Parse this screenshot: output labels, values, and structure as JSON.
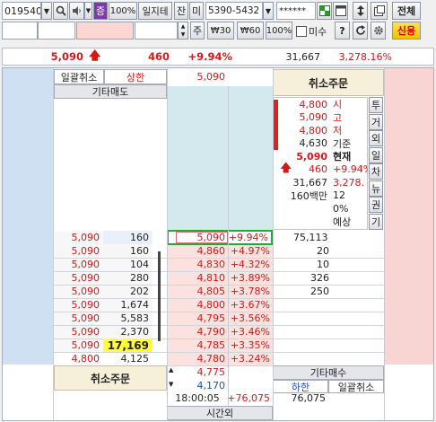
{
  "toolbar": {
    "code": "019540",
    "buttons": [
      "증",
      "100%",
      "일지테",
      "잔",
      "미"
    ],
    "range": "5390-5432",
    "password": "******",
    "all_label": "전체",
    "stepper_value": "",
    "step_up": "주",
    "qty_presets": [
      "₩30",
      "₩60",
      "100%"
    ],
    "unfilled_label": "미수",
    "help_label": "?",
    "credit_label": "신용"
  },
  "summary": {
    "price": "5,090",
    "change": "460",
    "change_pct": "+9.94%",
    "volume": "31,667",
    "amount": "3,278.16%"
  },
  "top": {
    "bulk_cancel": "일괄취소",
    "upper_limit_label": "상한",
    "upper_limit": "5,090",
    "other_sell": "기타매도",
    "cancel_order": "취소주문"
  },
  "info_panel": {
    "rows": [
      {
        "value": "4,800",
        "label": "시",
        "color": "red"
      },
      {
        "value": "5,090",
        "label": "고",
        "color": "red"
      },
      {
        "value": "4,800",
        "label": "저",
        "color": "red"
      },
      {
        "value": "4,630",
        "label": "기준",
        "color": "dark"
      },
      {
        "value": "5,090",
        "label": "현재",
        "color": "red"
      },
      {
        "value": "460",
        "label": "+9.94%",
        "color": "red"
      },
      {
        "value": "31,667",
        "label": "3,278.",
        "color": "mixed"
      },
      {
        "value": "160백만",
        "label": "12",
        "color": "dark"
      },
      {
        "value": "",
        "label": "0%",
        "color": "dark"
      },
      {
        "value": "",
        "label": "예상",
        "color": "dark"
      }
    ],
    "side_tabs": [
      "투",
      "거",
      "외",
      "일",
      "차",
      "뉴",
      "권",
      "기"
    ]
  },
  "current": {
    "price": "5,090",
    "pct": "+9.94%",
    "qty": "75,113"
  },
  "order_rows": [
    {
      "price": "5,090",
      "qty": "160",
      "ask": "4,860",
      "pct": "+4.97%",
      "vol": "20"
    },
    {
      "price": "5,090",
      "qty": "104",
      "ask": "4,830",
      "pct": "+4.32%",
      "vol": "10"
    },
    {
      "price": "5,090",
      "qty": "280",
      "ask": "4,810",
      "pct": "+3.89%",
      "vol": "326"
    },
    {
      "price": "5,090",
      "qty": "202",
      "ask": "4,805",
      "pct": "+3.78%",
      "vol": "250"
    },
    {
      "price": "5,090",
      "qty": "1,674",
      "ask": "4,800",
      "pct": "+3.67%",
      "vol": ""
    },
    {
      "price": "5,090",
      "qty": "5,583",
      "ask": "4,795",
      "pct": "+3.56%",
      "vol": ""
    },
    {
      "price": "5,090",
      "qty": "2,370",
      "ask": "4,790",
      "pct": "+3.46%",
      "vol": ""
    },
    {
      "price": "5,090",
      "qty": "17,169",
      "ask": "4,785",
      "pct": "+3.35%",
      "vol": ""
    },
    {
      "price": "4,800",
      "qty": "4,125",
      "ask": "4,780",
      "pct": "+3.24%",
      "vol": ""
    }
  ],
  "first_row_prefix": {
    "price": "5,090",
    "qty": "160"
  },
  "bottom": {
    "cancel_order": "취소주문",
    "bid1": "4,775",
    "bid2": "4,170",
    "other_buy": "기타매수",
    "lower_limit_label": "하한",
    "bulk_cancel": "일괄취소",
    "time": "18:00:05",
    "change": "+76,075",
    "total": "76,075",
    "after_hours": "시간외"
  }
}
